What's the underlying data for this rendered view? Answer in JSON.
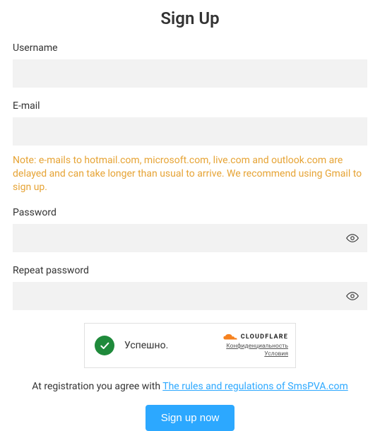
{
  "title": "Sign Up",
  "fields": {
    "username": {
      "label": "Username",
      "value": ""
    },
    "email": {
      "label": "E-mail",
      "value": ""
    },
    "password": {
      "label": "Password",
      "value": ""
    },
    "repeat": {
      "label": "Repeat password",
      "value": ""
    }
  },
  "email_note": "Note: e-mails to hotmail.com, microsoft.com, live.com and outlook.com are delayed and can take longer than usual to arrive. We recommend using Gmail to sign up.",
  "captcha": {
    "status_text": "Успешно.",
    "brand": "CLOUDFLARE",
    "privacy_label": "Конфиденциальность",
    "terms_label": "Условия"
  },
  "agreement": {
    "prefix": "At registration you agree with ",
    "link_text": "The rules and regulations of SmsPVA.com"
  },
  "submit_label": "Sign up now"
}
